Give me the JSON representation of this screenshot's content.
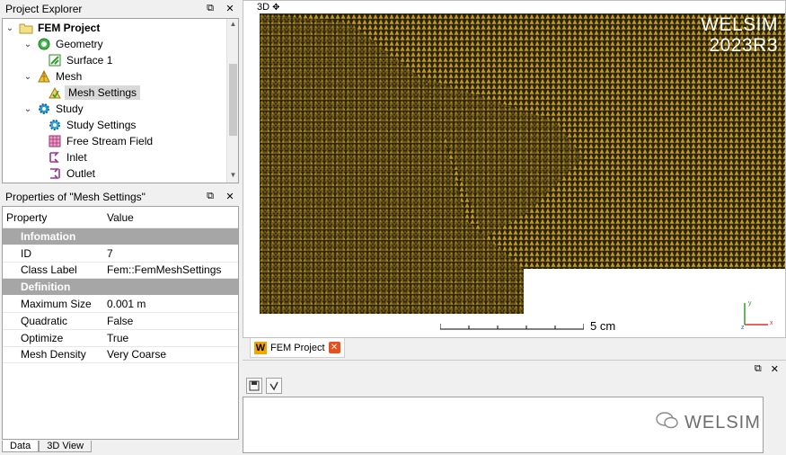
{
  "project_explorer": {
    "title": "Project Explorer",
    "items": [
      {
        "label": "FEM Project",
        "icon": "folder-icon",
        "expanded": true
      },
      {
        "label": "Geometry",
        "icon": "geometry-icon",
        "expanded": true
      },
      {
        "label": "Surface 1",
        "icon": "surface-icon"
      },
      {
        "label": "Mesh",
        "icon": "mesh-icon",
        "expanded": true
      },
      {
        "label": "Mesh Settings",
        "icon": "mesh-settings-icon",
        "selected": true
      },
      {
        "label": "Study",
        "icon": "study-gear-icon",
        "expanded": true
      },
      {
        "label": "Study Settings",
        "icon": "study-settings-icon"
      },
      {
        "label": "Free Stream Field",
        "icon": "field-icon"
      },
      {
        "label": "Inlet",
        "icon": "inlet-icon"
      },
      {
        "label": "Outlet",
        "icon": "outlet-icon"
      }
    ]
  },
  "properties": {
    "title": "Properties of \"Mesh Settings\"",
    "columns": [
      "Property",
      "Value"
    ],
    "sections": [
      {
        "name": "Infomation",
        "rows": [
          {
            "property": "ID",
            "value": "7"
          },
          {
            "property": "Class Label",
            "value": "Fem::FemMeshSettings"
          }
        ]
      },
      {
        "name": "Definition",
        "rows": [
          {
            "property": "Maximum Size",
            "value": "0.001 m"
          },
          {
            "property": "Quadratic",
            "value": "False"
          },
          {
            "property": "Optimize",
            "value": "True"
          },
          {
            "property": "Mesh Density",
            "value": "Very Coarse"
          }
        ]
      }
    ]
  },
  "bottom_tabs": [
    "Data",
    "3D View"
  ],
  "viewport": {
    "label": "3D",
    "logo_line1": "WELSIM",
    "logo_line2": "2023R3",
    "scale_label": "5 cm",
    "mesh_color": "#b8941a"
  },
  "doc_tab": {
    "label": "FEM Project",
    "logo_letter": "W"
  },
  "console": {},
  "watermark": "WELSIM"
}
